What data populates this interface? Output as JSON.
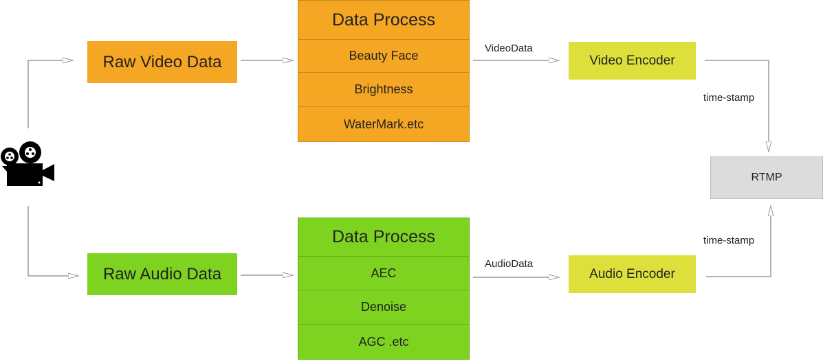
{
  "colors": {
    "video": "#F5A623",
    "audio": "#7ED321",
    "encoder": "#DDE03A",
    "rtmp": "#DCDCDC",
    "line": "#999999"
  },
  "source": {
    "icon": "movie-camera-icon"
  },
  "video": {
    "raw": "Raw Video Data",
    "process": {
      "title": "Data Process",
      "steps": [
        "Beauty Face",
        "Brightness",
        "WaterMark.etc"
      ]
    },
    "edge_label": "VideoData",
    "encoder": "Video Encoder",
    "timestamp": "time-stamp"
  },
  "audio": {
    "raw": "Raw Audio Data",
    "process": {
      "title": "Data Process",
      "steps": [
        "AEC",
        "Denoise",
        "AGC .etc"
      ]
    },
    "edge_label": "AudioData",
    "encoder": "Audio Encoder",
    "timestamp": "time-stamp"
  },
  "output": {
    "label": "RTMP"
  }
}
